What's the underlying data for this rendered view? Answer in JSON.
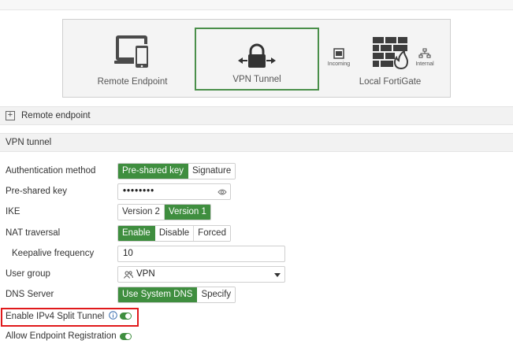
{
  "diagram": {
    "remote_endpoint": {
      "label": "Remote Endpoint",
      "icon": "devices-icon"
    },
    "vpn_tunnel": {
      "label": "VPN Tunnel",
      "icon": "lock-arrows-icon"
    },
    "incoming": {
      "label": "Incoming",
      "icon": "port-icon"
    },
    "local_fortigate": {
      "label": "Local FortiGate",
      "icon": "firewall-icon"
    },
    "internal": {
      "label": "Internal",
      "icon": "network-icon"
    }
  },
  "sections": {
    "remote_endpoint": "Remote endpoint",
    "vpn_tunnel": "VPN tunnel"
  },
  "form": {
    "auth_method": {
      "label": "Authentication method",
      "options": [
        "Pre-shared key",
        "Signature"
      ],
      "selected": "Pre-shared key"
    },
    "psk": {
      "label": "Pre-shared key",
      "value": "••••••••"
    },
    "ike": {
      "label": "IKE",
      "options": [
        "Version 2",
        "Version 1"
      ],
      "selected": "Version 1"
    },
    "nat": {
      "label": "NAT traversal",
      "options": [
        "Enable",
        "Disable",
        "Forced"
      ],
      "selected": "Enable"
    },
    "keepalive": {
      "label": "Keepalive frequency",
      "value": "10"
    },
    "user_group": {
      "label": "User group",
      "value": "VPN"
    },
    "dns": {
      "label": "DNS Server",
      "options": [
        "Use System DNS",
        "Specify"
      ],
      "selected": "Use System DNS"
    },
    "split_tunnel": {
      "label": "Enable IPv4 Split Tunnel",
      "enabled": true
    },
    "endpoint_reg": {
      "label": "Allow Endpoint Registration",
      "enabled": true
    }
  },
  "colors": {
    "accent": "#3f8e3f",
    "highlight": "#e0191b"
  }
}
